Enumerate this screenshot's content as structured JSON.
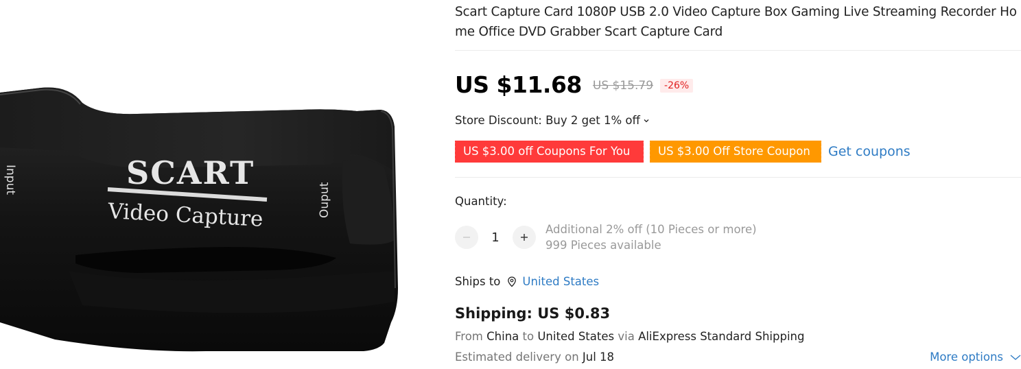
{
  "product": {
    "title": "Scart Capture Card 1080P USB 2.0 Video Capture Box Gaming Live Streaming Recorder Home Office DVD Grabber Scart Capture Card",
    "image": {
      "brand_text": "SCART",
      "sub_text": "Video Capture",
      "input_label": "Input",
      "output_label": "Ouput"
    }
  },
  "price": {
    "current": "US $11.68",
    "original": "US $15.79",
    "discount": "-26%"
  },
  "store_discount": {
    "text": "Store Discount: Buy 2 get 1% off"
  },
  "coupons": {
    "red_coupon": "US $3.00 off Coupons For You",
    "orange_coupon": "US $3.00 Off Store Coupon",
    "get_coupons": "Get coupons"
  },
  "quantity": {
    "label": "Quantity:",
    "value": "1",
    "additional": "Additional 2% off (10 Pieces or more)",
    "available": "999 Pieces available"
  },
  "ships": {
    "label": "Ships to",
    "country": "United States"
  },
  "shipping": {
    "title": "Shipping: US $0.83",
    "from_label": "From",
    "from": "China",
    "to_label": "to",
    "to": "United States",
    "via_label": "via",
    "method": "AliExpress Standard Shipping",
    "delivery_label": "Estimated delivery on",
    "delivery_date": "Jul 18",
    "more_options": "More options"
  },
  "colors": {
    "accent_link": "#2e7bc4",
    "coupon_red": "#ff3a3a",
    "coupon_orange": "#ff9800",
    "discount_text": "#e02020"
  },
  "icons": [
    "chevron-down-icon",
    "minus-icon",
    "plus-icon",
    "location-pin-icon",
    "more-options-chevron-icon"
  ]
}
